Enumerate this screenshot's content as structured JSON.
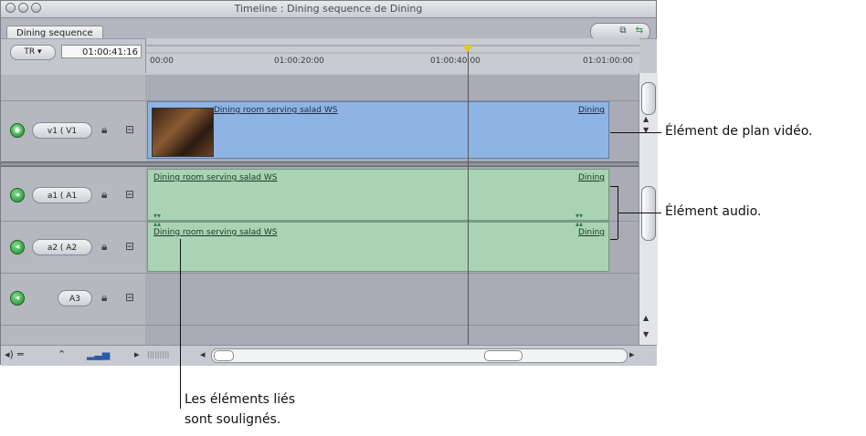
{
  "window": {
    "title": "Timeline : Dining sequence de Dining",
    "tab": "Dining sequence"
  },
  "header": {
    "track_menu": "TR",
    "timecode": "01:00:41:16",
    "ruler_labels": [
      "00:00",
      "01:00:20:00",
      "01:00:40:00",
      "01:01:00:00"
    ]
  },
  "tracks": {
    "v1": {
      "source": "v1",
      "dest": "V1"
    },
    "a1": {
      "source": "a1",
      "dest": "A1"
    },
    "a2": {
      "source": "a2",
      "dest": "A2"
    },
    "a3": {
      "dest": "A3"
    }
  },
  "clips": {
    "video_name": "Dining room serving salad WS",
    "video_next": "Dining",
    "audio1_name": "Dining room serving salad WS",
    "audio1_next": "Dining",
    "audio2_name": "Dining room serving salad WS",
    "audio2_next": "Dining"
  },
  "annotations": {
    "video_clip": "Élément de plan vidéo.",
    "audio_clip": "Élément audio.",
    "linked_line1": "Les éléments liés",
    "linked_line2": "sont soulignés."
  },
  "icons": {
    "lock": "lock-icon",
    "sync": "sync-icon",
    "track_visibility": "visibility-icon"
  }
}
